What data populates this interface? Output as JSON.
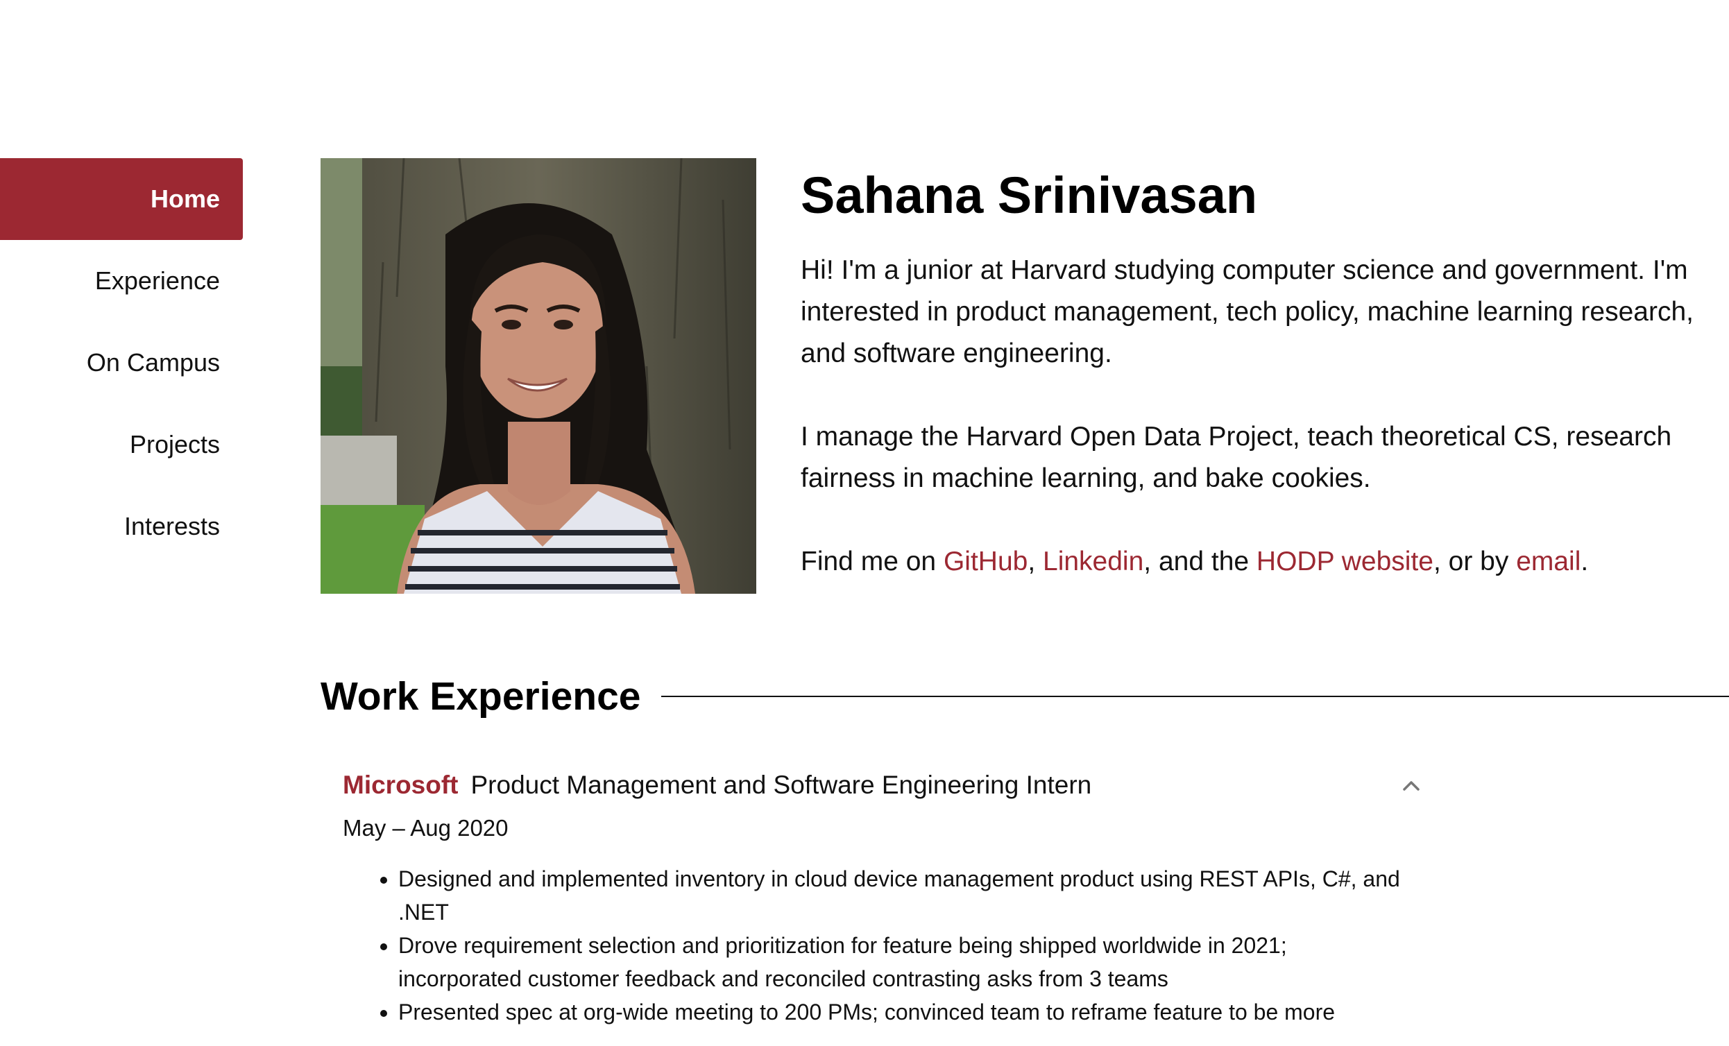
{
  "nav": {
    "items": [
      {
        "label": "Home",
        "active": true
      },
      {
        "label": "Experience",
        "active": false
      },
      {
        "label": "On Campus",
        "active": false
      },
      {
        "label": "Projects",
        "active": false
      },
      {
        "label": "Interests",
        "active": false
      }
    ]
  },
  "intro": {
    "name": "Sahana Srinivasan",
    "p1": "Hi! I'm a junior at Harvard studying computer science and government. I'm interested in product management, tech policy, machine learning research, and software engineering.",
    "p2": "I manage the Harvard Open Data Project, teach theoretical CS, research fairness in machine learning, and bake cookies.",
    "p3": {
      "prefix": "Find me on ",
      "github": "GitHub",
      "sep1": ", ",
      "linkedin": "Linkedin",
      "sep2": ", and the ",
      "hodp": "HODP website",
      "sep3": ", or by ",
      "email": "email",
      "suffix": "."
    }
  },
  "work": {
    "heading": "Work Experience",
    "jobs": [
      {
        "company": "Microsoft",
        "role": "Product Management and Software Engineering Intern",
        "dates": "May – Aug 2020",
        "bullets": [
          "Designed and implemented inventory in cloud device management product using REST APIs, C#, and .NET",
          "Drove requirement selection and prioritization for feature being shipped worldwide in 2021; incorporated customer feedback and reconciled contrasting asks from 3 teams",
          "Presented spec at org-wide meeting to 200 PMs; convinced team to reframe feature to be more"
        ]
      }
    ]
  },
  "colors": {
    "accent": "#9c2832",
    "text": "#111111",
    "background": "#ffffff"
  },
  "icons": {
    "collapse": "chevron-up-icon"
  }
}
